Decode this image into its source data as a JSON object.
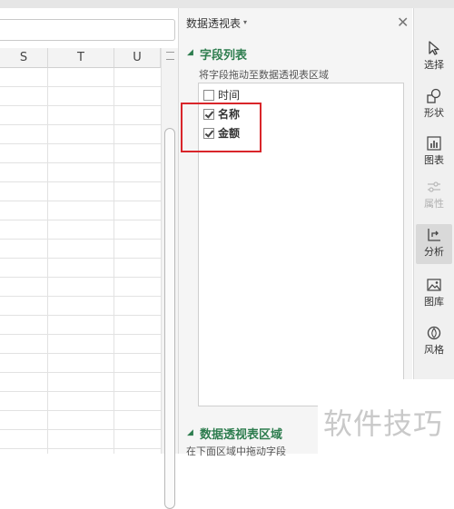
{
  "spreadsheet": {
    "columns": [
      "S",
      "T",
      "U"
    ]
  },
  "pivot_panel": {
    "title": "数据透视表",
    "field_list": {
      "heading": "字段列表",
      "hint": "将字段拖动至数据透视表区域",
      "fields": [
        {
          "label": "时间",
          "checked": false
        },
        {
          "label": "名称",
          "checked": true
        },
        {
          "label": "金额",
          "checked": true
        }
      ]
    },
    "pivot_area": {
      "heading": "数据透视表区域",
      "hint": "在下面区域中拖动字段"
    }
  },
  "toolbar": {
    "items": [
      {
        "label": "选择",
        "icon": "cursor-icon",
        "enabled": true
      },
      {
        "label": "形状",
        "icon": "shapes-icon",
        "enabled": true
      },
      {
        "label": "图表",
        "icon": "chart-icon",
        "enabled": true
      },
      {
        "label": "属性",
        "icon": "sliders-icon",
        "enabled": false
      },
      {
        "label": "分析",
        "icon": "analyze-icon",
        "enabled": true,
        "active": true
      },
      {
        "label": "图库",
        "icon": "picture-icon",
        "enabled": true
      },
      {
        "label": "风格",
        "icon": "style-icon",
        "enabled": true
      }
    ]
  },
  "watermark": "软件技巧",
  "colors": {
    "accent_green": "#2e7d4f",
    "highlight_red": "#d9252a"
  }
}
